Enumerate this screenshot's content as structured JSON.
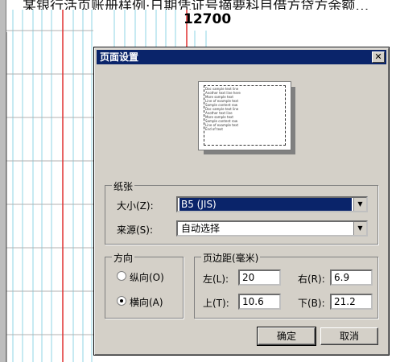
{
  "background": {
    "top_text": "某银行活页账册样例·日期凭证号摘要科目借方贷方余额…",
    "number": "12700"
  },
  "dialog": {
    "title": "页面设置",
    "close_icon": "close-icon",
    "preview_text": "Doc sample text line\nAnother text line here\nMore sample text\nLine of example text\nSample content row\nDoc sample text line\nAnother text line\nMore sample text\nSample content row\nLine of example text\nEnd of text",
    "paper": {
      "group_label": "纸张",
      "size_label": "大小(Z):",
      "size_value": "B5 (JIS)",
      "source_label": "来源(S):",
      "source_value": "自动选择"
    },
    "orientation": {
      "group_label": "方向",
      "portrait_label": "纵向(O)",
      "landscape_label": "横向(A)",
      "selected": "landscape"
    },
    "margins": {
      "group_label": "页边距(毫米)",
      "left_label": "左(L):",
      "left_value": "20",
      "right_label": "右(R):",
      "right_value": "6.9",
      "top_label": "上(T):",
      "top_value": "10.6",
      "bottom_label": "下(B):",
      "bottom_value": "21.2"
    },
    "ok_label": "确定",
    "cancel_label": "取消"
  }
}
